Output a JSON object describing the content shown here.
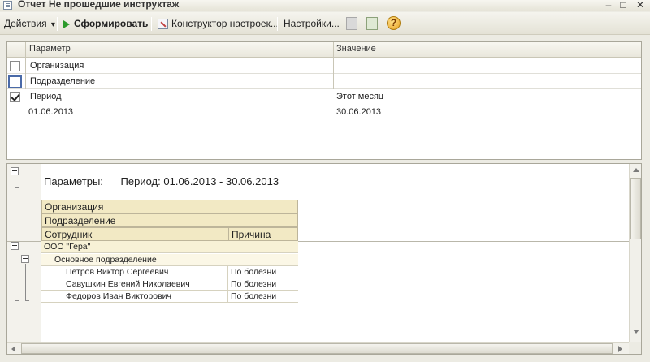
{
  "window": {
    "title": "Отчет  Не прошедшие инструктаж",
    "minimize": "–",
    "maximize": "□",
    "close": "✕"
  },
  "toolbar": {
    "actions_label": "Действия",
    "actions_arrow": "▾",
    "generate_label": "Сформировать",
    "constructor_label": "Конструктор настроек...",
    "settings_label": "Настройки...",
    "help_label": "?"
  },
  "params_table": {
    "columns": [
      "Параметр",
      "Значение"
    ],
    "rows": [
      {
        "checked": false,
        "name": "Организация",
        "value": ""
      },
      {
        "checked": false,
        "name": "Подразделение",
        "value": ""
      },
      {
        "checked": true,
        "name": "Период",
        "value": "Этот месяц"
      }
    ],
    "period_from": "01.06.2013",
    "period_to": "30.06.2013"
  },
  "report": {
    "params_label": "Параметры:",
    "params_value": "Период: 01.06.2013 - 30.06.2013",
    "headers": {
      "organization": "Организация",
      "department": "Подразделение",
      "employee": "Сотрудник",
      "reason": "Причина"
    },
    "group": "ООО \"Гера\"",
    "subgroup": "Основное подразделение",
    "rows": [
      {
        "employee": "Петров Виктор Сергеевич",
        "reason": "По болезни"
      },
      {
        "employee": "Савушкин Евгений Николаевич",
        "reason": "По болезни"
      },
      {
        "employee": "Федоров Иван Викторович",
        "reason": "По болезни"
      }
    ]
  }
}
